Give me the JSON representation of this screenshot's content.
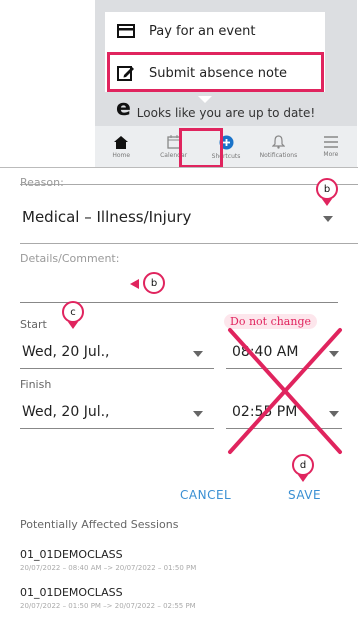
{
  "menu": {
    "pay_label": "Pay for an event",
    "absence_label": "Submit absence note",
    "pay_icon": "credit-card-icon",
    "absence_icon": "edit-note-icon"
  },
  "status": {
    "uptodate": "Looks like you are up to date!"
  },
  "side_char": "e",
  "nav": [
    {
      "label": "Home",
      "icon": "home-icon"
    },
    {
      "label": "Calendar",
      "icon": "calendar-icon"
    },
    {
      "label": "Shortcuts",
      "icon": "plus-circle-icon"
    },
    {
      "label": "Notifications",
      "icon": "bell-icon"
    },
    {
      "label": "More",
      "icon": "menu-icon"
    }
  ],
  "form": {
    "reason_label": "Reason:",
    "reason_value": "Medical – Illness/Injury",
    "details_label": "Details/Comment:",
    "details_value": "",
    "start_label": "Start",
    "start_date": "Wed, 20 Jul.,",
    "start_time": "08:40 AM",
    "finish_label": "Finish",
    "finish_date": "Wed, 20 Jul.,",
    "finish_time": "02:55 PM",
    "do_not_change": "Do not change",
    "cancel": "CANCEL",
    "save": "SAVE"
  },
  "pins": {
    "b": "b",
    "c": "c",
    "d": "d"
  },
  "sessions": {
    "title": "Potentially Affected Sessions",
    "items": [
      {
        "name": "01_01DEMOCLASS",
        "time": "20/07/2022 – 08:40 AM –> 20/07/2022 – 01:50 PM"
      },
      {
        "name": "01_01DEMOCLASS",
        "time": "20/07/2022 – 01:50 PM –> 20/07/2022 – 02:55 PM"
      }
    ]
  },
  "colors": {
    "highlight": "#e0245e",
    "accent": "#3a8fd3",
    "nav_active": "#1a73c9"
  }
}
